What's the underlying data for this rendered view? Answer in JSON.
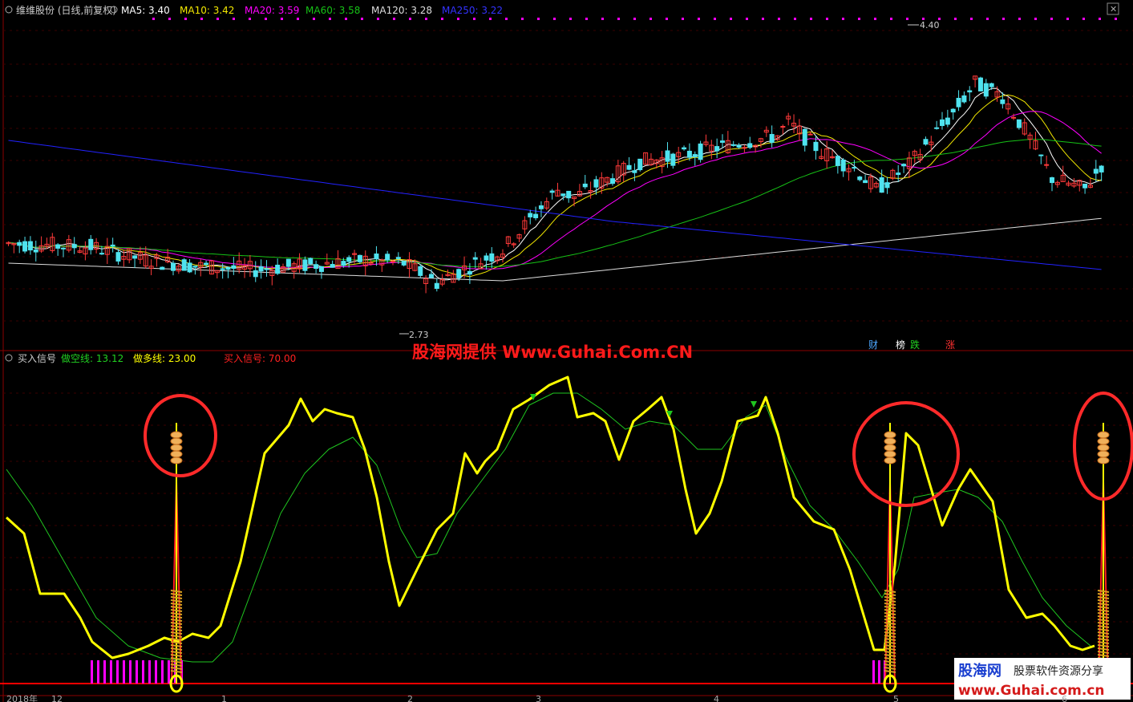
{
  "colors": {
    "bg": "#000000",
    "grid": "#3a0000",
    "up": "#ff3a3a",
    "down": "#4fe3ef",
    "ma5": "#ffffff",
    "ma10": "#f2e700",
    "ma20": "#ff00ff",
    "ma60": "#16c116",
    "ma120": "#dddddd",
    "ma250": "#2222ff",
    "yellow": "#ffff00",
    "green": "#1fc41f",
    "red": "#ff2020",
    "magenta": "#ff00ff",
    "circle": "#ff2a2a"
  },
  "header": {
    "stock": "维维股份 (日线,前复权)",
    "ma5": "MA5: 3.40",
    "ma10": "MA10: 3.42",
    "ma20": "MA20: 3.59",
    "ma60": "MA60: 3.58",
    "ma120": "MA120: 3.28",
    "ma250": "MA250: 3.22"
  },
  "price_panel": {
    "high_label": "4.40",
    "low_label": "2.73",
    "event_markers": [
      "财",
      "榜",
      "跌",
      "涨"
    ]
  },
  "indicator_header": {
    "name": "买入信号",
    "short_line": "做空线: 13.12",
    "long_line": "做多线: 23.00",
    "buy_signal": "买入信号: 70.00"
  },
  "watermark": "股海网提供 Www.Guhai.Com.CN",
  "brand": {
    "logo": "股海网",
    "slogan": "股票软件资源分享",
    "url": "www.Guhai.com.cn"
  },
  "x_axis": {
    "labels": [
      "2018年",
      "12",
      "1",
      "2",
      "3",
      "4",
      "5",
      "6"
    ]
  },
  "chart_data": [
    {
      "type": "candlestick",
      "title": "维维股份 (日线,前复权)",
      "y_min": 2.73,
      "y_max": 4.4,
      "series": [
        {
          "name": "MA5",
          "last": 3.4
        },
        {
          "name": "MA10",
          "last": 3.42
        },
        {
          "name": "MA20",
          "last": 3.59
        },
        {
          "name": "MA60",
          "last": 3.58
        },
        {
          "name": "MA120",
          "last": 3.28
        },
        {
          "name": "MA250",
          "last": 3.22
        }
      ]
    },
    {
      "type": "line",
      "title": "买入信号",
      "series": [
        {
          "name": "做空线",
          "last": 13.12
        },
        {
          "name": "做多线",
          "last": 23.0
        },
        {
          "name": "买入信号",
          "last": 70.0
        }
      ]
    }
  ]
}
